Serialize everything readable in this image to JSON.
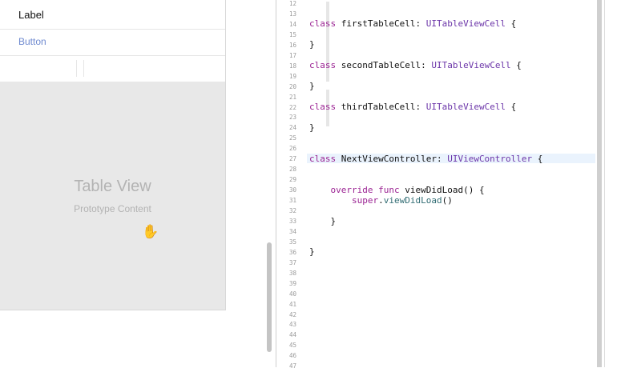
{
  "canvas": {
    "label_cell": "Label",
    "button_cell": "Button",
    "table_view_title": "Table View",
    "table_view_subtitle": "Prototype Content",
    "cursor_icon": "open-hand-cursor"
  },
  "editor": {
    "line_numbers": [
      "12",
      "13",
      "14",
      "15",
      "16",
      "17",
      "18",
      "19",
      "20",
      "21",
      "22",
      "23",
      "24",
      "25",
      "26",
      "27",
      "28",
      "29",
      "30",
      "31",
      "32",
      "33",
      "34",
      "35",
      "36",
      "37",
      "38",
      "39",
      "40",
      "41",
      "42",
      "43",
      "44",
      "45",
      "46",
      "47"
    ],
    "lines": [
      {
        "tokens": []
      },
      {
        "tokens": [
          {
            "t": "class",
            "c": "kw"
          },
          {
            "t": " firstTableCell: "
          },
          {
            "t": "UITableViewCell",
            "c": "ty"
          },
          {
            "t": " {"
          }
        ]
      },
      {
        "tokens": []
      },
      {
        "tokens": [
          {
            "t": "}"
          }
        ]
      },
      {
        "tokens": []
      },
      {
        "tokens": [
          {
            "t": "class",
            "c": "kw"
          },
          {
            "t": " secondTableCell: "
          },
          {
            "t": "UITableViewCell",
            "c": "ty"
          },
          {
            "t": " {"
          }
        ]
      },
      {
        "tokens": []
      },
      {
        "tokens": [
          {
            "t": "}"
          }
        ]
      },
      {
        "tokens": []
      },
      {
        "tokens": [
          {
            "t": "class",
            "c": "kw"
          },
          {
            "t": " thirdTableCell: "
          },
          {
            "t": "UITableViewCell",
            "c": "ty"
          },
          {
            "t": " {"
          }
        ]
      },
      {
        "tokens": []
      },
      {
        "tokens": [
          {
            "t": "}"
          }
        ]
      },
      {
        "tokens": []
      },
      {
        "tokens": []
      },
      {
        "tokens": [
          {
            "t": "class",
            "c": "kw"
          },
          {
            "t": " NextViewController: "
          },
          {
            "t": "UIViewController",
            "c": "ty"
          },
          {
            "t": " {"
          }
        ]
      },
      {
        "tokens": []
      },
      {
        "tokens": []
      },
      {
        "tokens": [
          {
            "t": "    "
          },
          {
            "t": "override",
            "c": "kw"
          },
          {
            "t": " "
          },
          {
            "t": "func",
            "c": "kw"
          },
          {
            "t": " viewDidLoad() {"
          }
        ]
      },
      {
        "tokens": [
          {
            "t": "        "
          },
          {
            "t": "super",
            "c": "kw"
          },
          {
            "t": "."
          },
          {
            "t": "viewDidLoad",
            "c": "fn"
          },
          {
            "t": "()"
          }
        ]
      },
      {
        "tokens": []
      },
      {
        "tokens": [
          {
            "t": "    }"
          }
        ]
      },
      {
        "tokens": []
      },
      {
        "tokens": []
      },
      {
        "tokens": [
          {
            "t": "}"
          }
        ]
      }
    ]
  }
}
